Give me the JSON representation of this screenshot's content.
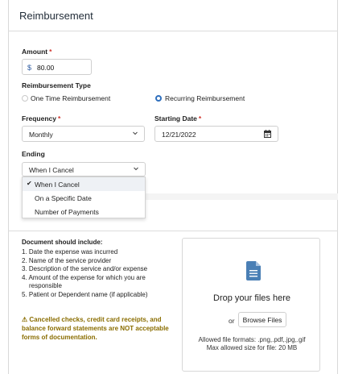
{
  "header": {
    "title": "Reimbursement"
  },
  "amount": {
    "label": "Amount",
    "required_mark": "*",
    "currency": "$",
    "value": "80.00"
  },
  "reimbursement_type": {
    "label": "Reimbursement Type",
    "options": [
      {
        "label": "One Time Reimbursement",
        "selected": false
      },
      {
        "label": "Recurring Reimbursement",
        "selected": true
      }
    ]
  },
  "frequency": {
    "label": "Frequency",
    "required_mark": "*",
    "value": "Monthly",
    "icon": "chevron-down-icon"
  },
  "starting_date": {
    "label": "Starting Date",
    "required_mark": "*",
    "value": "12/21/2022",
    "icon": "calendar-icon"
  },
  "ending": {
    "label": "Ending",
    "value": "When I Cancel",
    "icon": "chevron-down-icon",
    "options": [
      {
        "label": "When I Cancel",
        "selected": true,
        "check": "✔"
      },
      {
        "label": "On a Specific Date",
        "selected": false
      },
      {
        "label": "Number of Payments",
        "selected": false
      }
    ]
  },
  "documents": {
    "title": "Document should include:",
    "items": [
      "1. Date the expense was incurred",
      "2. Name of the service provider",
      "3. Description of the service and/or expense",
      "4. Amount of the expense for which you are",
      "responsible",
      "5. Patient or Dependent name (if applicable)"
    ],
    "warning_icon": "⚠",
    "warning": "Cancelled checks, credit card receipts, and balance forward statements are NOT acceptable forms of documentation."
  },
  "upload": {
    "icon": "document-icon",
    "drop_text": "Drop your files here",
    "or_text": "or",
    "browse_label": "Browse Files",
    "allowed_formats": "Allowed file formats: .png,.pdf,.jpg,.gif",
    "max_size": "Max allowed size for file: 20 MB"
  },
  "colors": {
    "accent": "#2f6fbd",
    "required": "#d0342c",
    "warning": "#8a6d00",
    "file_icon": "#4a7fb5"
  }
}
